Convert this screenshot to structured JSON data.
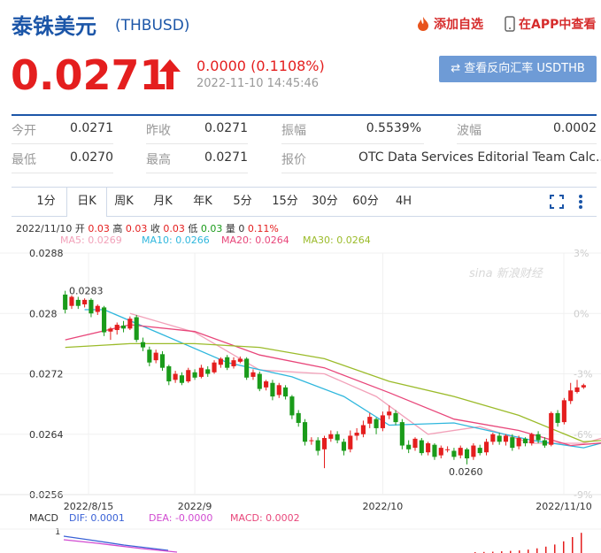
{
  "header": {
    "title": "泰铢美元",
    "code": "(THBUSD)",
    "add_watchlist": "添加自选",
    "view_in_app": "在APP中查看"
  },
  "quote": {
    "price": "0.0271",
    "change": "0.0000 (0.1108%)",
    "time": "2022-11-10 14:45:46",
    "reverse_button": "⇄ 查看反向汇率 USDTHB"
  },
  "stats": {
    "row1": [
      {
        "label": "今开",
        "value": "0.0271"
      },
      {
        "label": "昨收",
        "value": "0.0271"
      },
      {
        "label": "振幅",
        "value": "0.5539%"
      },
      {
        "label": "波幅",
        "value": "0.0002"
      }
    ],
    "row2": [
      {
        "label": "最低",
        "value": "0.0270"
      },
      {
        "label": "最高",
        "value": "0.0271"
      },
      {
        "label": "报价",
        "value": "OTC Data Services Editorial Team Calc..."
      }
    ]
  },
  "tabs": [
    "1分",
    "日K",
    "周K",
    "月K",
    "年K",
    "5分",
    "15分",
    "30分",
    "60分",
    "4H"
  ],
  "active_tab": 1,
  "ohlc": {
    "date": "2022/11/10",
    "open_label": "开",
    "open": "0.03",
    "high_label": "高",
    "high": "0.03",
    "close_label": "收",
    "close": "0.03",
    "low_label": "低",
    "low": "0.03",
    "vol_label": "量",
    "vol": "0",
    "pct": "0.11%"
  },
  "ma_legend": [
    {
      "text": "MA5: 0.0269",
      "color": "#f2a1b9"
    },
    {
      "text": "MA10: 0.0266",
      "color": "#2fb7dd"
    },
    {
      "text": "MA20: 0.0264",
      "color": "#e8467a"
    },
    {
      "text": "MA30: 0.0264",
      "color": "#9bbb2a"
    }
  ],
  "macd_legend": {
    "label": "MACD",
    "dif": "DIF: 0.0001",
    "dea": "DEA: -0.0000",
    "macd": "MACD: 0.0002",
    "axis_top": "1"
  },
  "watermark": "sina 新浪财经",
  "chart_data": {
    "type": "candlestick",
    "y_ticks": [
      "0.0288",
      "0.028",
      "0.0272",
      "0.0264",
      "0.0256"
    ],
    "y_tick_values": [
      0.0288,
      0.028,
      0.0272,
      0.0264,
      0.0256
    ],
    "y_right_ticks": [
      "3%",
      "0%",
      "-3%",
      "-6%",
      "-9%"
    ],
    "ylim": [
      0.0256,
      0.0288
    ],
    "x_ticks": [
      "2022/8/15",
      "2022/9",
      "2022/10",
      "2022/11/10"
    ],
    "annotations": [
      {
        "text": "0.0283",
        "value": 0.0283
      },
      {
        "text": "0.0260",
        "value": 0.026
      }
    ],
    "candles": [
      [
        0.02825,
        0.02805,
        0.0283,
        0.028
      ],
      [
        0.0281,
        0.02822,
        0.02824,
        0.02806
      ],
      [
        0.02818,
        0.0281,
        0.02822,
        0.02806
      ],
      [
        0.02812,
        0.02818,
        0.0282,
        0.02808
      ],
      [
        0.02818,
        0.028,
        0.0282,
        0.02795
      ],
      [
        0.02802,
        0.0281,
        0.02812,
        0.02798
      ],
      [
        0.02808,
        0.02775,
        0.0281,
        0.0277
      ],
      [
        0.02776,
        0.0278,
        0.02782,
        0.02765
      ],
      [
        0.02778,
        0.02785,
        0.02788,
        0.02772
      ],
      [
        0.02784,
        0.0278,
        0.0279,
        0.02775
      ],
      [
        0.0278,
        0.02793,
        0.02796,
        0.02778
      ],
      [
        0.02795,
        0.02765,
        0.02798,
        0.02762
      ],
      [
        0.02762,
        0.02755,
        0.02768,
        0.0275
      ],
      [
        0.02752,
        0.02735,
        0.02756,
        0.0273
      ],
      [
        0.02738,
        0.02748,
        0.02752,
        0.02734
      ],
      [
        0.02746,
        0.02728,
        0.0275,
        0.02724
      ],
      [
        0.0273,
        0.0271,
        0.02732,
        0.02705
      ],
      [
        0.02712,
        0.0272,
        0.02724,
        0.02708
      ],
      [
        0.02718,
        0.02708,
        0.02722,
        0.02705
      ],
      [
        0.0271,
        0.02725,
        0.02728,
        0.02708
      ],
      [
        0.02722,
        0.02715,
        0.02726,
        0.02712
      ],
      [
        0.02716,
        0.02728,
        0.02732,
        0.02714
      ],
      [
        0.02726,
        0.0272,
        0.0273,
        0.02716
      ],
      [
        0.02722,
        0.02735,
        0.02738,
        0.0272
      ],
      [
        0.02732,
        0.0274,
        0.02742,
        0.02728
      ],
      [
        0.02742,
        0.02728,
        0.02745,
        0.02725
      ],
      [
        0.0273,
        0.02738,
        0.02742,
        0.02727
      ],
      [
        0.02736,
        0.0274,
        0.02743,
        0.02734
      ],
      [
        0.0274,
        0.02715,
        0.02742,
        0.02712
      ],
      [
        0.02716,
        0.02722,
        0.02726,
        0.02712
      ],
      [
        0.0272,
        0.027,
        0.02723,
        0.02697
      ],
      [
        0.02702,
        0.0271,
        0.02712,
        0.02698
      ],
      [
        0.02708,
        0.0269,
        0.02712,
        0.02685
      ],
      [
        0.02692,
        0.02705,
        0.02708,
        0.02688
      ],
      [
        0.02702,
        0.0269,
        0.02705,
        0.02686
      ],
      [
        0.0269,
        0.02665,
        0.02692,
        0.0266
      ],
      [
        0.02668,
        0.02655,
        0.02672,
        0.0265
      ],
      [
        0.02656,
        0.0263,
        0.0266,
        0.02625
      ],
      [
        0.02632,
        0.02632,
        0.02636,
        0.02626
      ],
      [
        0.02632,
        0.02618,
        0.02636,
        0.02612
      ],
      [
        0.0262,
        0.02635,
        0.02638,
        0.02595
      ],
      [
        0.02634,
        0.0264,
        0.02645,
        0.0263
      ],
      [
        0.0264,
        0.02632,
        0.02644,
        0.02628
      ],
      [
        0.0263,
        0.02618,
        0.02634,
        0.02612
      ],
      [
        0.0262,
        0.02638,
        0.02645,
        0.02616
      ],
      [
        0.02638,
        0.02642,
        0.02648,
        0.02632
      ],
      [
        0.0264,
        0.02652,
        0.02658,
        0.02636
      ],
      [
        0.02654,
        0.02663,
        0.02668,
        0.02648
      ],
      [
        0.0266,
        0.02648,
        0.02662,
        0.0264
      ],
      [
        0.02648,
        0.02665,
        0.0267,
        0.02644
      ],
      [
        0.02665,
        0.0267,
        0.02678,
        0.0266
      ],
      [
        0.02668,
        0.02656,
        0.02672,
        0.02652
      ],
      [
        0.02656,
        0.02625,
        0.0266,
        0.0262
      ],
      [
        0.02626,
        0.0262,
        0.02632,
        0.02615
      ],
      [
        0.02622,
        0.02634,
        0.02636,
        0.02618
      ],
      [
        0.02632,
        0.02615,
        0.02635,
        0.02612
      ],
      [
        0.02616,
        0.02628,
        0.0263,
        0.02612
      ],
      [
        0.02626,
        0.0261,
        0.02628,
        0.02606
      ],
      [
        0.02612,
        0.02622,
        0.02625,
        0.02608
      ],
      [
        0.0262,
        0.0262,
        0.02624,
        0.02616
      ],
      [
        0.02618,
        0.0261,
        0.02622,
        0.02606
      ],
      [
        0.02612,
        0.02622,
        0.02625,
        0.02608
      ],
      [
        0.0262,
        0.02608,
        0.02622,
        0.026
      ],
      [
        0.0261,
        0.02625,
        0.02628,
        0.02606
      ],
      [
        0.02622,
        0.02615,
        0.02626,
        0.02612
      ],
      [
        0.02616,
        0.0263,
        0.02634,
        0.02612
      ],
      [
        0.0263,
        0.0264,
        0.02642,
        0.02626
      ],
      [
        0.02638,
        0.0263,
        0.02642,
        0.02626
      ],
      [
        0.0263,
        0.02638,
        0.0264,
        0.02625
      ],
      [
        0.02636,
        0.02622,
        0.0264,
        0.02618
      ],
      [
        0.02624,
        0.02635,
        0.02638,
        0.0262
      ],
      [
        0.02634,
        0.02628,
        0.02636,
        0.02624
      ],
      [
        0.02628,
        0.0264,
        0.02642,
        0.02625
      ],
      [
        0.0264,
        0.02632,
        0.02644,
        0.02628
      ],
      [
        0.02632,
        0.02625,
        0.02636,
        0.02622
      ],
      [
        0.02626,
        0.02668,
        0.0267,
        0.02624
      ],
      [
        0.02668,
        0.02655,
        0.02672,
        0.0265
      ],
      [
        0.02656,
        0.02685,
        0.02688,
        0.02653
      ],
      [
        0.02684,
        0.02698,
        0.02708,
        0.0268
      ],
      [
        0.02696,
        0.02702,
        0.02712,
        0.02694
      ],
      [
        0.02702,
        0.02705,
        0.02707,
        0.027
      ]
    ],
    "ma": [
      {
        "name": "MA5",
        "color": "#f2a1b9",
        "points": [
          [
            10,
            0.028
          ],
          [
            20,
            0.02775
          ],
          [
            30,
            0.02725
          ],
          [
            40,
            0.0272
          ],
          [
            48,
            0.0269
          ],
          [
            56,
            0.0264
          ],
          [
            64,
            0.0265
          ],
          [
            72,
            0.02628
          ],
          [
            80,
            0.02628
          ],
          [
            87,
            0.02645
          ],
          [
            92,
            0.0269
          ]
        ]
      },
      {
        "name": "MA10",
        "color": "#2fb7dd",
        "points": [
          [
            3,
            0.02805
          ],
          [
            6,
            0.02805
          ],
          [
            15,
            0.02772
          ],
          [
            25,
            0.02735
          ],
          [
            35,
            0.02716
          ],
          [
            43,
            0.0269
          ],
          [
            50,
            0.02652
          ],
          [
            60,
            0.02655
          ],
          [
            72,
            0.02632
          ],
          [
            80,
            0.02622
          ],
          [
            88,
            0.0264
          ],
          [
            92,
            0.0266
          ]
        ]
      },
      {
        "name": "MA20",
        "color": "#e8467a",
        "points": [
          [
            0,
            0.02765
          ],
          [
            10,
            0.02785
          ],
          [
            20,
            0.02776
          ],
          [
            30,
            0.02745
          ],
          [
            40,
            0.02728
          ],
          [
            50,
            0.02695
          ],
          [
            60,
            0.0266
          ],
          [
            70,
            0.02645
          ],
          [
            78,
            0.02625
          ],
          [
            85,
            0.0263
          ],
          [
            92,
            0.0264
          ]
        ]
      },
      {
        "name": "MA30",
        "color": "#9bbb2a",
        "points": [
          [
            0,
            0.02755
          ],
          [
            10,
            0.0276
          ],
          [
            20,
            0.0276
          ],
          [
            30,
            0.02755
          ],
          [
            40,
            0.0274
          ],
          [
            50,
            0.0271
          ],
          [
            60,
            0.0269
          ],
          [
            70,
            0.02665
          ],
          [
            80,
            0.0263
          ],
          [
            88,
            0.02635
          ],
          [
            92,
            0.0264
          ]
        ]
      }
    ],
    "macd_bars": [
      0.04,
      0.05,
      0.06,
      0.08,
      0.1,
      0.12,
      0.16,
      0.22,
      0.3,
      0.4,
      0.55,
      0.75,
      0.95
    ]
  }
}
